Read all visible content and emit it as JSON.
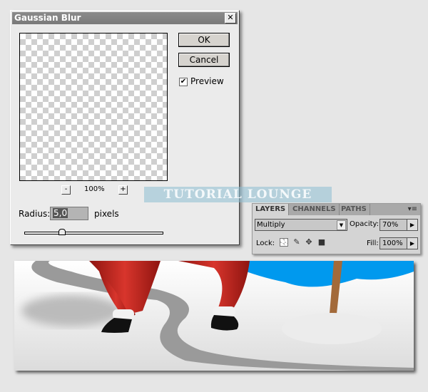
{
  "dialog": {
    "title": "Gaussian Blur",
    "close_icon": "close-icon",
    "ok_label": "OK",
    "cancel_label": "Cancel",
    "preview_label": "Preview",
    "preview_checked": true,
    "check_glyph": "✔",
    "zoom_out": "-",
    "zoom_in": "+",
    "zoom_level": "100%",
    "radius_label": "Radius:",
    "radius_value": "5,0",
    "radius_unit": "pixels"
  },
  "watermark": "TUTORIAL LOUNGE",
  "layers_panel": {
    "tabs": [
      "LAYERS",
      "CHANNELS",
      "PATHS"
    ],
    "menu_icon": "▾≡",
    "blend_mode": "Multiply",
    "opacity_label": "Opacity:",
    "opacity_value": "70%",
    "lock_label": "Lock:",
    "fill_label": "Fill:",
    "fill_value": "100%"
  },
  "colors": {
    "sky": "#0099ee",
    "suit": "#c0211a",
    "snow": "#f4f4f4",
    "road": "#9a9a9a"
  }
}
